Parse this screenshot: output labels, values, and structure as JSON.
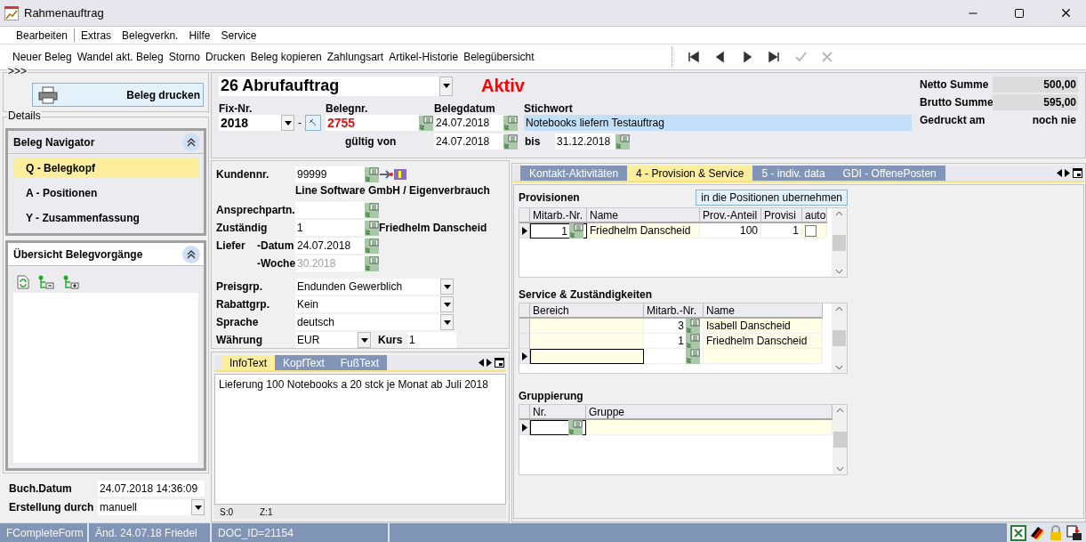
{
  "window": {
    "title": "Rahmenauftrag"
  },
  "menu": [
    {
      "label": "Bearbeiten",
      "separator_after": true
    },
    {
      "label": "Extras",
      "separator_after": false
    },
    {
      "label": "Belegverkn.",
      "separator_after": false
    },
    {
      "label": "Hilfe",
      "separator_after": false
    },
    {
      "label": "Service",
      "separator_after": false
    }
  ],
  "toolbar": [
    "Neuer Beleg",
    "Wandel akt. Beleg",
    "Storno",
    "Drucken",
    "Beleg kopieren",
    "Zahlungsart",
    "Artikel-Historie",
    "Belegübersicht"
  ],
  "record_nav": [
    {
      "kind": "first",
      "disabled": false
    },
    {
      "kind": "prev",
      "disabled": false
    },
    {
      "kind": "next",
      "disabled": false
    },
    {
      "kind": "last",
      "disabled": false
    },
    {
      "kind": "confirm",
      "disabled": true
    },
    {
      "kind": "cancel",
      "disabled": true
    }
  ],
  "left": {
    "group_label": ">>>",
    "print_button": "Beleg drucken",
    "details_label": "Details",
    "navigator": {
      "title": "Beleg Navigator",
      "items": [
        {
          "label": "Q - Belegkopf",
          "selected": true
        },
        {
          "label": "A - Positionen",
          "selected": false
        },
        {
          "label": "Y - Zusammenfassung",
          "selected": false
        }
      ]
    },
    "overview": {
      "title": "Übersicht Belegvorgänge"
    },
    "booking": [
      {
        "kind": "text",
        "label": "Buch.Datum",
        "value": "24.07.2018 14:36:09"
      },
      {
        "kind": "combo",
        "label": "Erstellung durch",
        "value": "manuell"
      }
    ]
  },
  "header": {
    "doc_type": "26 Abrufauftrag",
    "status": "Aktiv",
    "fix_label": "Fix-Nr.",
    "fix_value": "2018",
    "dash": "-",
    "beleg_label": "Belegnr.",
    "beleg_value": "2755",
    "date_label": "Belegdatum",
    "date_value": "24.07.2018",
    "keyword_label": "Stichwort",
    "keyword_value": "Notebooks liefern Testauftrag",
    "valid_label": "gültig von",
    "valid_from": "24.07.2018",
    "until_label": "bis",
    "valid_until": "31.12.2018"
  },
  "totals": [
    {
      "label": "Netto Summe",
      "value": "500,00",
      "kind": "amount"
    },
    {
      "label": "Brutto Summe",
      "value": "595,00",
      "kind": "amount"
    },
    {
      "label": "Gedruckt am",
      "value": "noch nie",
      "kind": "info"
    }
  ],
  "customer": {
    "number_label": "Kundennr.",
    "number": "99999",
    "name": "Line Software GmbH / Eigenverbrauch",
    "contact_label": "Ansprechpartn.",
    "responsible_label": "Zuständig",
    "responsible": "1",
    "responsible_name": "Friedhelm Danscheid",
    "delivery_label": "Liefer",
    "date_label": "-Datum",
    "date": "24.07.2018",
    "week_label": "-Woche",
    "week": "30.2018",
    "week_disabled": true
  },
  "combos": [
    {
      "label": "Preisgrp.",
      "value": "Endunden Gewerblich"
    },
    {
      "label": "Rabattgrp.",
      "value": "Kein"
    },
    {
      "label": "Sprache",
      "value": "deutsch"
    }
  ],
  "currency": {
    "label": "Währung",
    "value": "EUR",
    "rate_label": "Kurs",
    "rate": "1"
  },
  "text_tabs": [
    {
      "label": "InfoText",
      "selected": true
    },
    {
      "label": "KopfText",
      "selected": false
    },
    {
      "label": "FußText",
      "selected": false
    }
  ],
  "info_text": "Lieferung 100 Notebooks a 20 stck je Monat ab Juli 2018",
  "editor_status": [
    "S:0",
    "Z:1"
  ],
  "detail_tabs": [
    {
      "label": "Kontakt-Aktivitäten",
      "selected": false
    },
    {
      "label": "4 - Provision & Service",
      "selected": true
    },
    {
      "label": "5 - indiv. data",
      "selected": false
    },
    {
      "label": "GDI - OffenePosten",
      "selected": false
    }
  ],
  "provisions": {
    "title": "Provisionen",
    "button": "in die Positionen ubernehmen",
    "columns": [
      "Mitarb.-Nr.",
      "Name",
      "Prov.-Anteil",
      "Provisi",
      "auto"
    ],
    "rows": [
      {
        "nr": "1",
        "name": "Friedhelm Danscheid",
        "share": "100",
        "provisi": "1",
        "auto": false,
        "current": true
      }
    ]
  },
  "service": {
    "title": "Service & Zuständigkeiten",
    "columns": [
      "Bereich",
      "Mitarb.-Nr.",
      "Name"
    ],
    "rows": [
      {
        "nr": "3",
        "name": "Isabell Danscheid",
        "current": false
      },
      {
        "nr": "1",
        "name": "Friedhelm Danscheid",
        "current": false
      },
      {
        "current": true
      }
    ]
  },
  "grouping": {
    "title": "Gruppierung",
    "columns": [
      "Nr.",
      "Gruppe"
    ],
    "rows": [
      {
        "current": true
      }
    ]
  },
  "status_bar": [
    "FCompleteForm",
    "Änd. 24.07.18 Friedel",
    "DOC_ID=21154"
  ]
}
